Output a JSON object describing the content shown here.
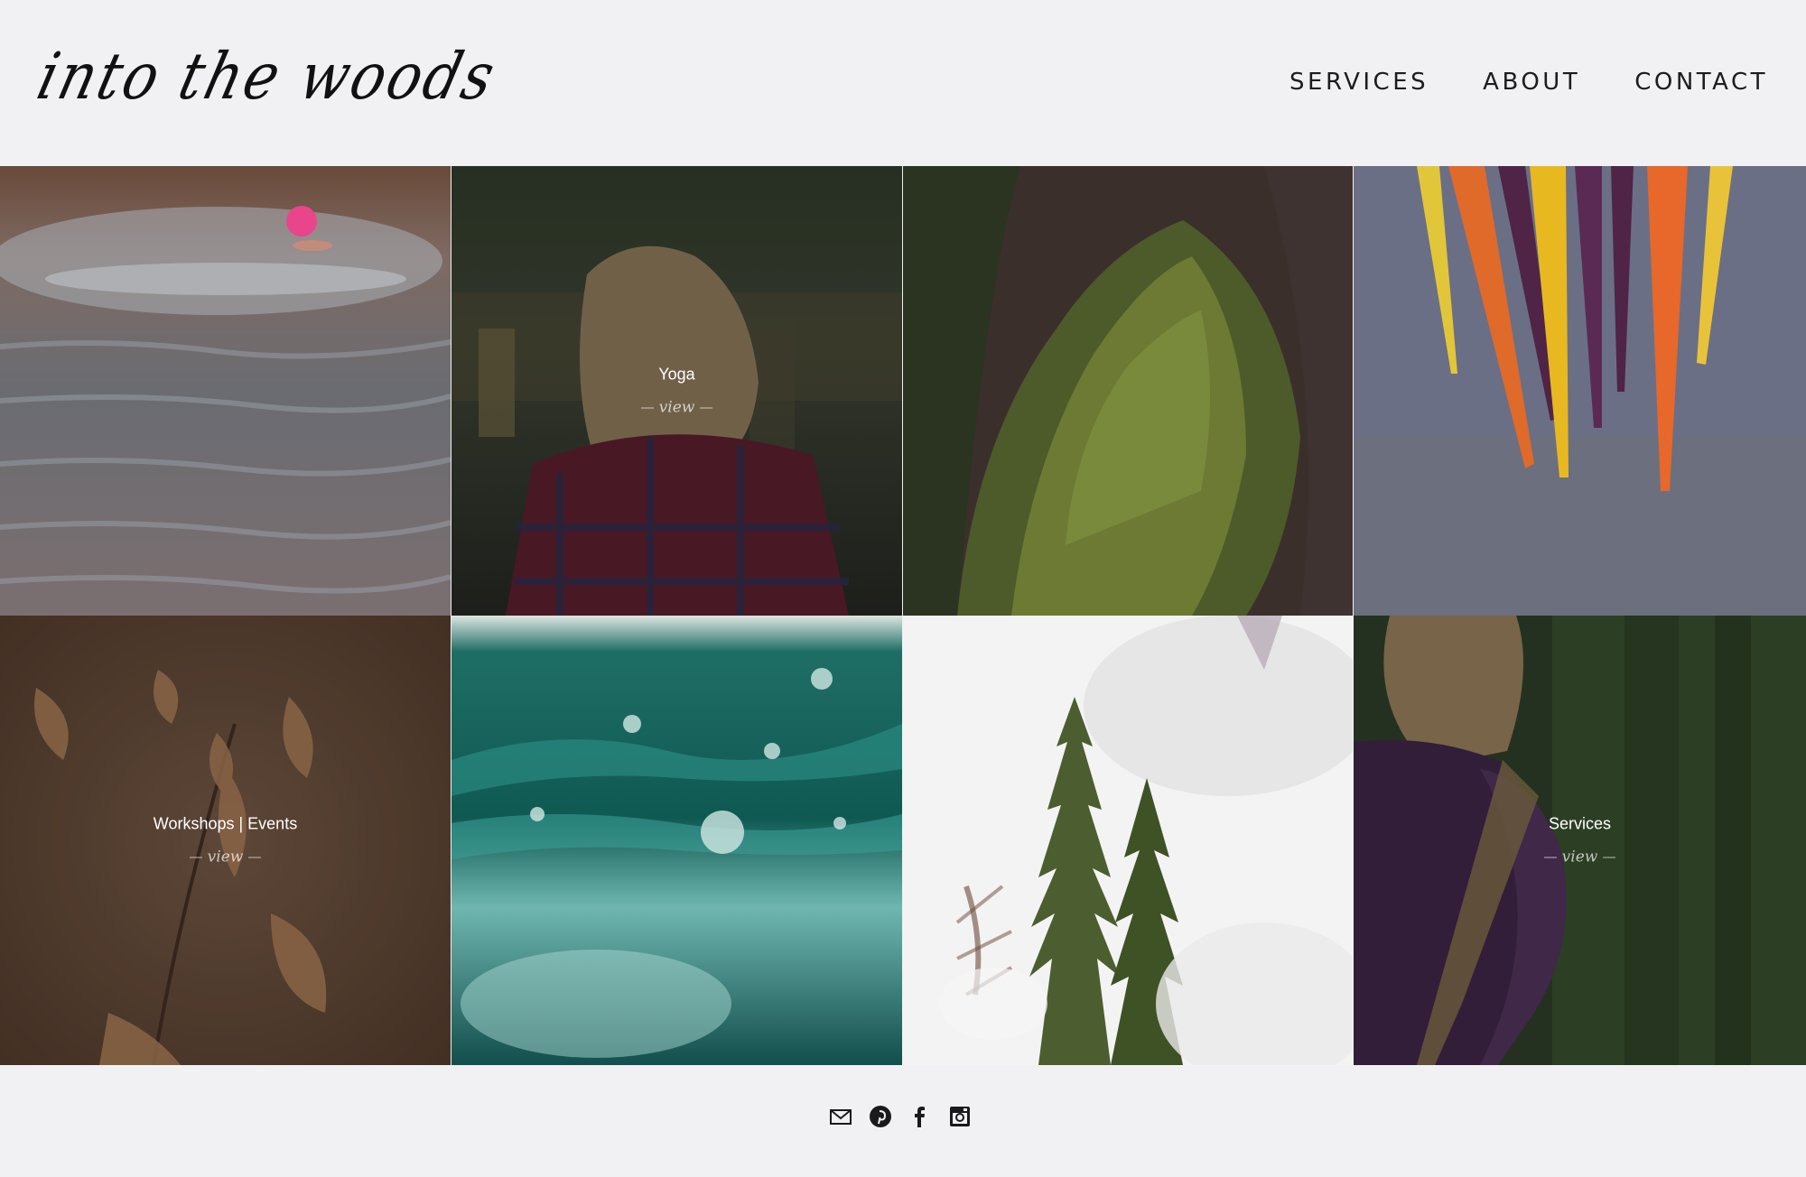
{
  "header": {
    "logo_text": "into the woods",
    "nav": [
      "SERVICES",
      "ABOUT",
      "CONTACT"
    ]
  },
  "tiles": [
    {
      "image": "swimmer-in-lake",
      "title": "",
      "view": ""
    },
    {
      "image": "woman-plaid-shirt-lake",
      "title": "Yoga",
      "view": "view"
    },
    {
      "image": "moss-on-bark",
      "title": "",
      "view": ""
    },
    {
      "image": "rainbow-carrots-on-wood",
      "title": "",
      "view": ""
    },
    {
      "image": "dry-autumn-leaves",
      "title": "Workshops | Events",
      "view": "view"
    },
    {
      "image": "teal-water-bubbles",
      "title": "",
      "view": ""
    },
    {
      "image": "pine-trees-double-exposure",
      "title": "",
      "view": ""
    },
    {
      "image": "woman-purple-shirt-forest",
      "title": "Services",
      "view": "view"
    }
  ],
  "footer": {
    "icons": [
      "mail-icon",
      "pinterest-icon",
      "facebook-icon",
      "instagram-icon"
    ]
  }
}
